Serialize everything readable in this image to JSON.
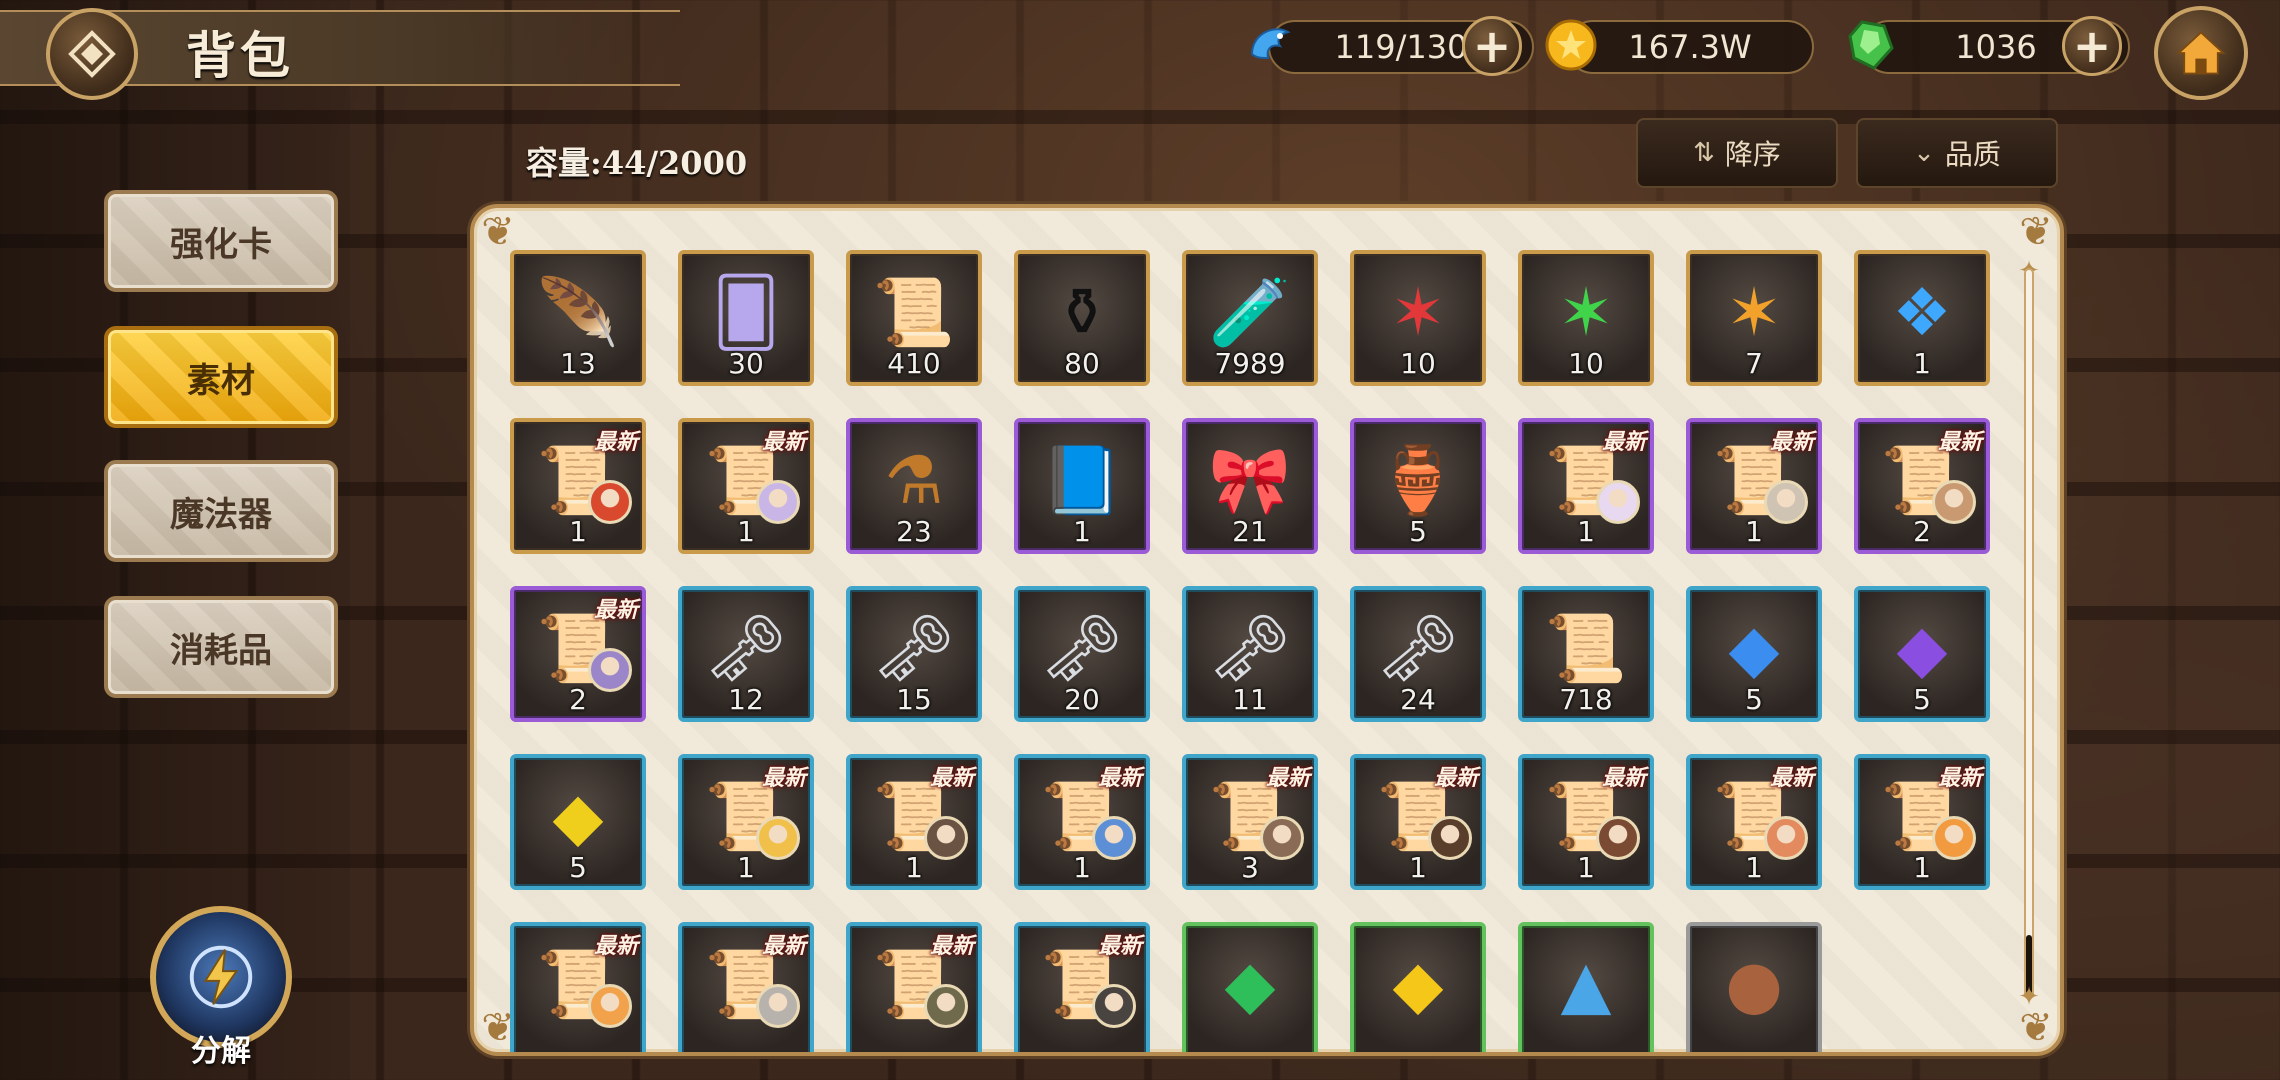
{
  "header": {
    "title": "背包",
    "stamina": "119/130",
    "gold": "167.3W",
    "gems": "1036"
  },
  "capacity": "容量:44/2000",
  "sort": {
    "order_label": "降序",
    "quality_label": "品质"
  },
  "categories": [
    {
      "label": "强化卡",
      "active": false
    },
    {
      "label": "素材",
      "active": true
    },
    {
      "label": "魔法器",
      "active": false
    },
    {
      "label": "消耗品",
      "active": false
    }
  ],
  "decompose_label": "分解",
  "new_badge": "最新",
  "items": [
    {
      "name": "feather",
      "qty": "13",
      "rarity": "gold",
      "new": false
    },
    {
      "name": "cards",
      "qty": "30",
      "rarity": "gold",
      "new": false
    },
    {
      "name": "scroll",
      "qty": "410",
      "rarity": "gold",
      "new": false
    },
    {
      "name": "ink-pot",
      "qty": "80",
      "rarity": "gold",
      "new": false
    },
    {
      "name": "potion-bottle",
      "qty": "7989",
      "rarity": "gold",
      "new": false
    },
    {
      "name": "red-stars",
      "qty": "10",
      "rarity": "gold",
      "new": false
    },
    {
      "name": "green-stars",
      "qty": "10",
      "rarity": "gold",
      "new": false
    },
    {
      "name": "orange-stars",
      "qty": "7",
      "rarity": "gold",
      "new": false
    },
    {
      "name": "blue-crystal",
      "qty": "1",
      "rarity": "gold",
      "new": false
    },
    {
      "name": "character-scroll",
      "qty": "1",
      "rarity": "gold",
      "new": true,
      "portrait": "#d9492e"
    },
    {
      "name": "character-scroll",
      "qty": "1",
      "rarity": "gold",
      "new": true,
      "portrait": "#c9b6e6"
    },
    {
      "name": "ink-bottle",
      "qty": "23",
      "rarity": "purple",
      "new": false
    },
    {
      "name": "book",
      "qty": "1",
      "rarity": "purple",
      "new": false
    },
    {
      "name": "ribbon",
      "qty": "21",
      "rarity": "purple",
      "new": false
    },
    {
      "name": "milk-jar",
      "qty": "5",
      "rarity": "purple",
      "new": false
    },
    {
      "name": "character-scroll",
      "qty": "1",
      "rarity": "purple",
      "new": true,
      "portrait": "#e8d8f0"
    },
    {
      "name": "character-scroll",
      "qty": "1",
      "rarity": "purple",
      "new": true,
      "portrait": "#cfc3b4"
    },
    {
      "name": "character-scroll",
      "qty": "2",
      "rarity": "purple",
      "new": true,
      "portrait": "#c99a72"
    },
    {
      "name": "character-scroll",
      "qty": "2",
      "rarity": "purple",
      "new": true,
      "portrait": "#9a86c9"
    },
    {
      "name": "silver-key",
      "qty": "12",
      "rarity": "blue",
      "new": false
    },
    {
      "name": "silver-key",
      "qty": "15",
      "rarity": "blue",
      "new": false
    },
    {
      "name": "silver-key",
      "qty": "20",
      "rarity": "blue",
      "new": false
    },
    {
      "name": "silver-key",
      "qty": "11",
      "rarity": "blue",
      "new": false
    },
    {
      "name": "silver-key",
      "qty": "24",
      "rarity": "blue",
      "new": false
    },
    {
      "name": "paper-scroll",
      "qty": "718",
      "rarity": "blue",
      "new": false
    },
    {
      "name": "blue-gem",
      "qty": "5",
      "rarity": "blue",
      "new": false
    },
    {
      "name": "purple-gem",
      "qty": "5",
      "rarity": "blue",
      "new": false
    },
    {
      "name": "yellow-gem",
      "qty": "5",
      "rarity": "blue",
      "new": false
    },
    {
      "name": "character-scroll",
      "qty": "1",
      "rarity": "blue",
      "new": true,
      "portrait": "#f0c04a"
    },
    {
      "name": "character-scroll",
      "qty": "1",
      "rarity": "blue",
      "new": true,
      "portrait": "#6b5344"
    },
    {
      "name": "character-scroll",
      "qty": "1",
      "rarity": "blue",
      "new": true,
      "portrait": "#5d8fd6"
    },
    {
      "name": "character-scroll",
      "qty": "3",
      "rarity": "blue",
      "new": true,
      "portrait": "#8a6b56"
    },
    {
      "name": "character-scroll",
      "qty": "1",
      "rarity": "blue",
      "new": true,
      "portrait": "#5a3e2c"
    },
    {
      "name": "character-scroll",
      "qty": "1",
      "rarity": "blue",
      "new": true,
      "portrait": "#7a4a32"
    },
    {
      "name": "character-scroll",
      "qty": "1",
      "rarity": "blue",
      "new": true,
      "portrait": "#e38a5e"
    },
    {
      "name": "character-scroll",
      "qty": "1",
      "rarity": "blue",
      "new": true,
      "portrait": "#f29a3f"
    },
    {
      "name": "character-scroll",
      "qty": "",
      "rarity": "blue",
      "new": true,
      "portrait": "#f2a24a"
    },
    {
      "name": "character-scroll",
      "qty": "",
      "rarity": "blue",
      "new": true,
      "portrait": "#b8b2ad"
    },
    {
      "name": "character-scroll",
      "qty": "",
      "rarity": "blue",
      "new": true,
      "portrait": "#6f6a4c"
    },
    {
      "name": "character-scroll",
      "qty": "",
      "rarity": "blue",
      "new": true,
      "portrait": "#4a4440"
    },
    {
      "name": "green-crystal",
      "qty": "",
      "rarity": "green",
      "new": false
    },
    {
      "name": "yellow-crystal",
      "qty": "",
      "rarity": "green",
      "new": false
    },
    {
      "name": "blue-crystal-pile",
      "qty": "",
      "rarity": "green",
      "new": false
    },
    {
      "name": "fist-coin",
      "qty": "",
      "rarity": "grey",
      "new": false
    }
  ]
}
